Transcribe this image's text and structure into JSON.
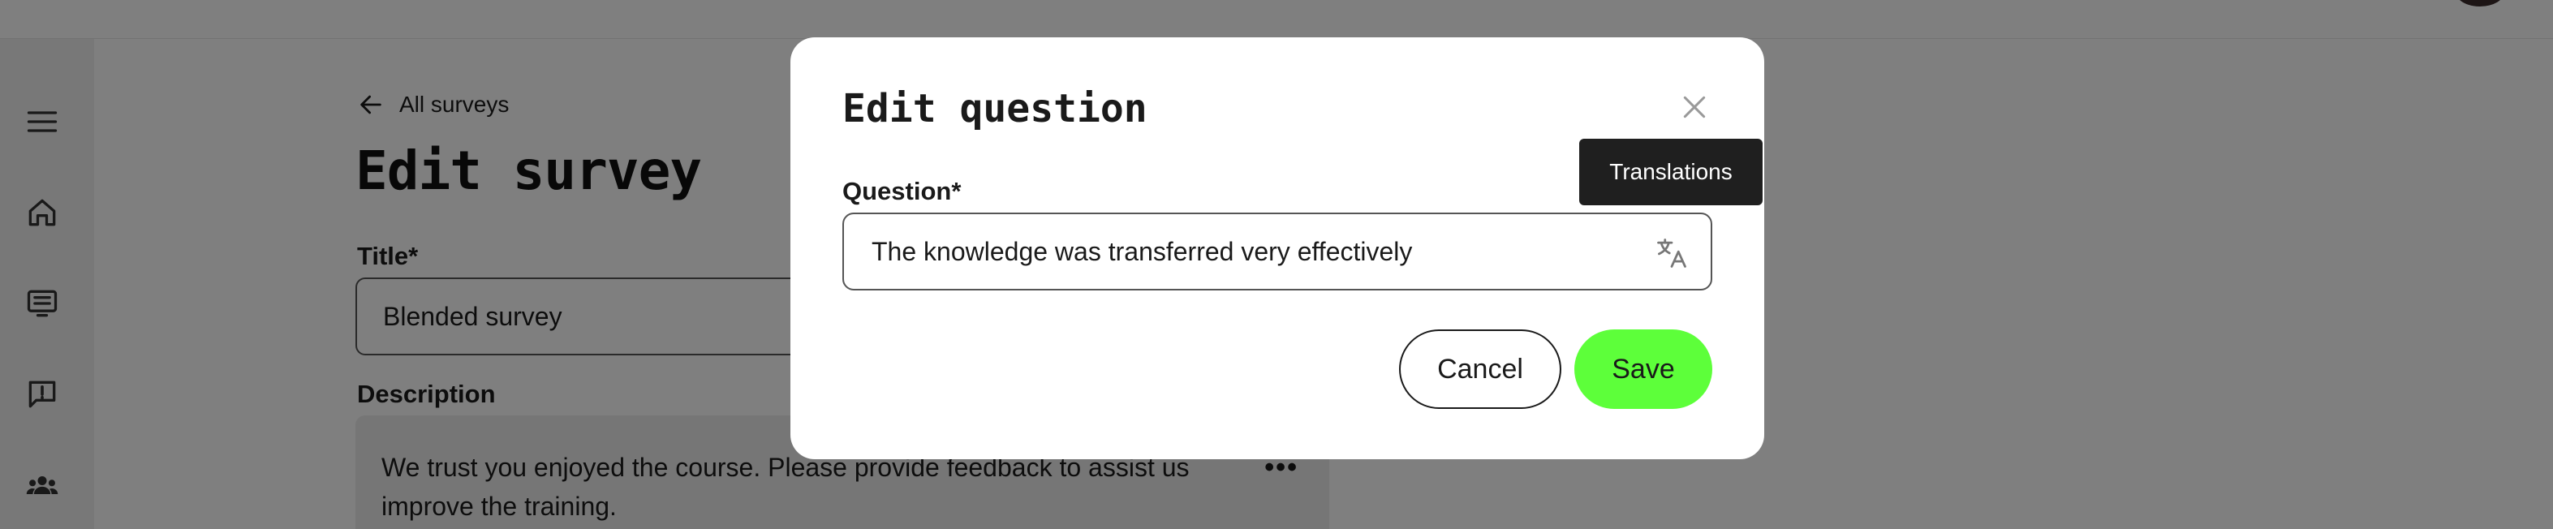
{
  "nav": {
    "icons": [
      "menu-icon",
      "home-icon",
      "courses-icon",
      "feedback-icon",
      "people-icon"
    ]
  },
  "page": {
    "back_link": "All surveys",
    "title": "Edit survey",
    "title_label": "Title*",
    "title_value": "Blended survey",
    "description_label": "Description",
    "description_value": "We trust you enjoyed the course. Please provide feedback to assist us improve the training.",
    "description_more": "•••"
  },
  "modal": {
    "title": "Edit question",
    "question_label": "Question*",
    "question_value": "The knowledge was transferred very effectively",
    "translate_tooltip": "Translations",
    "cancel_label": "Cancel",
    "save_label": "Save"
  },
  "colors": {
    "overlay": "rgba(0,0,0,0.5)",
    "save_button": "#5dff3a",
    "tooltip_bg": "#1f1f1f"
  }
}
